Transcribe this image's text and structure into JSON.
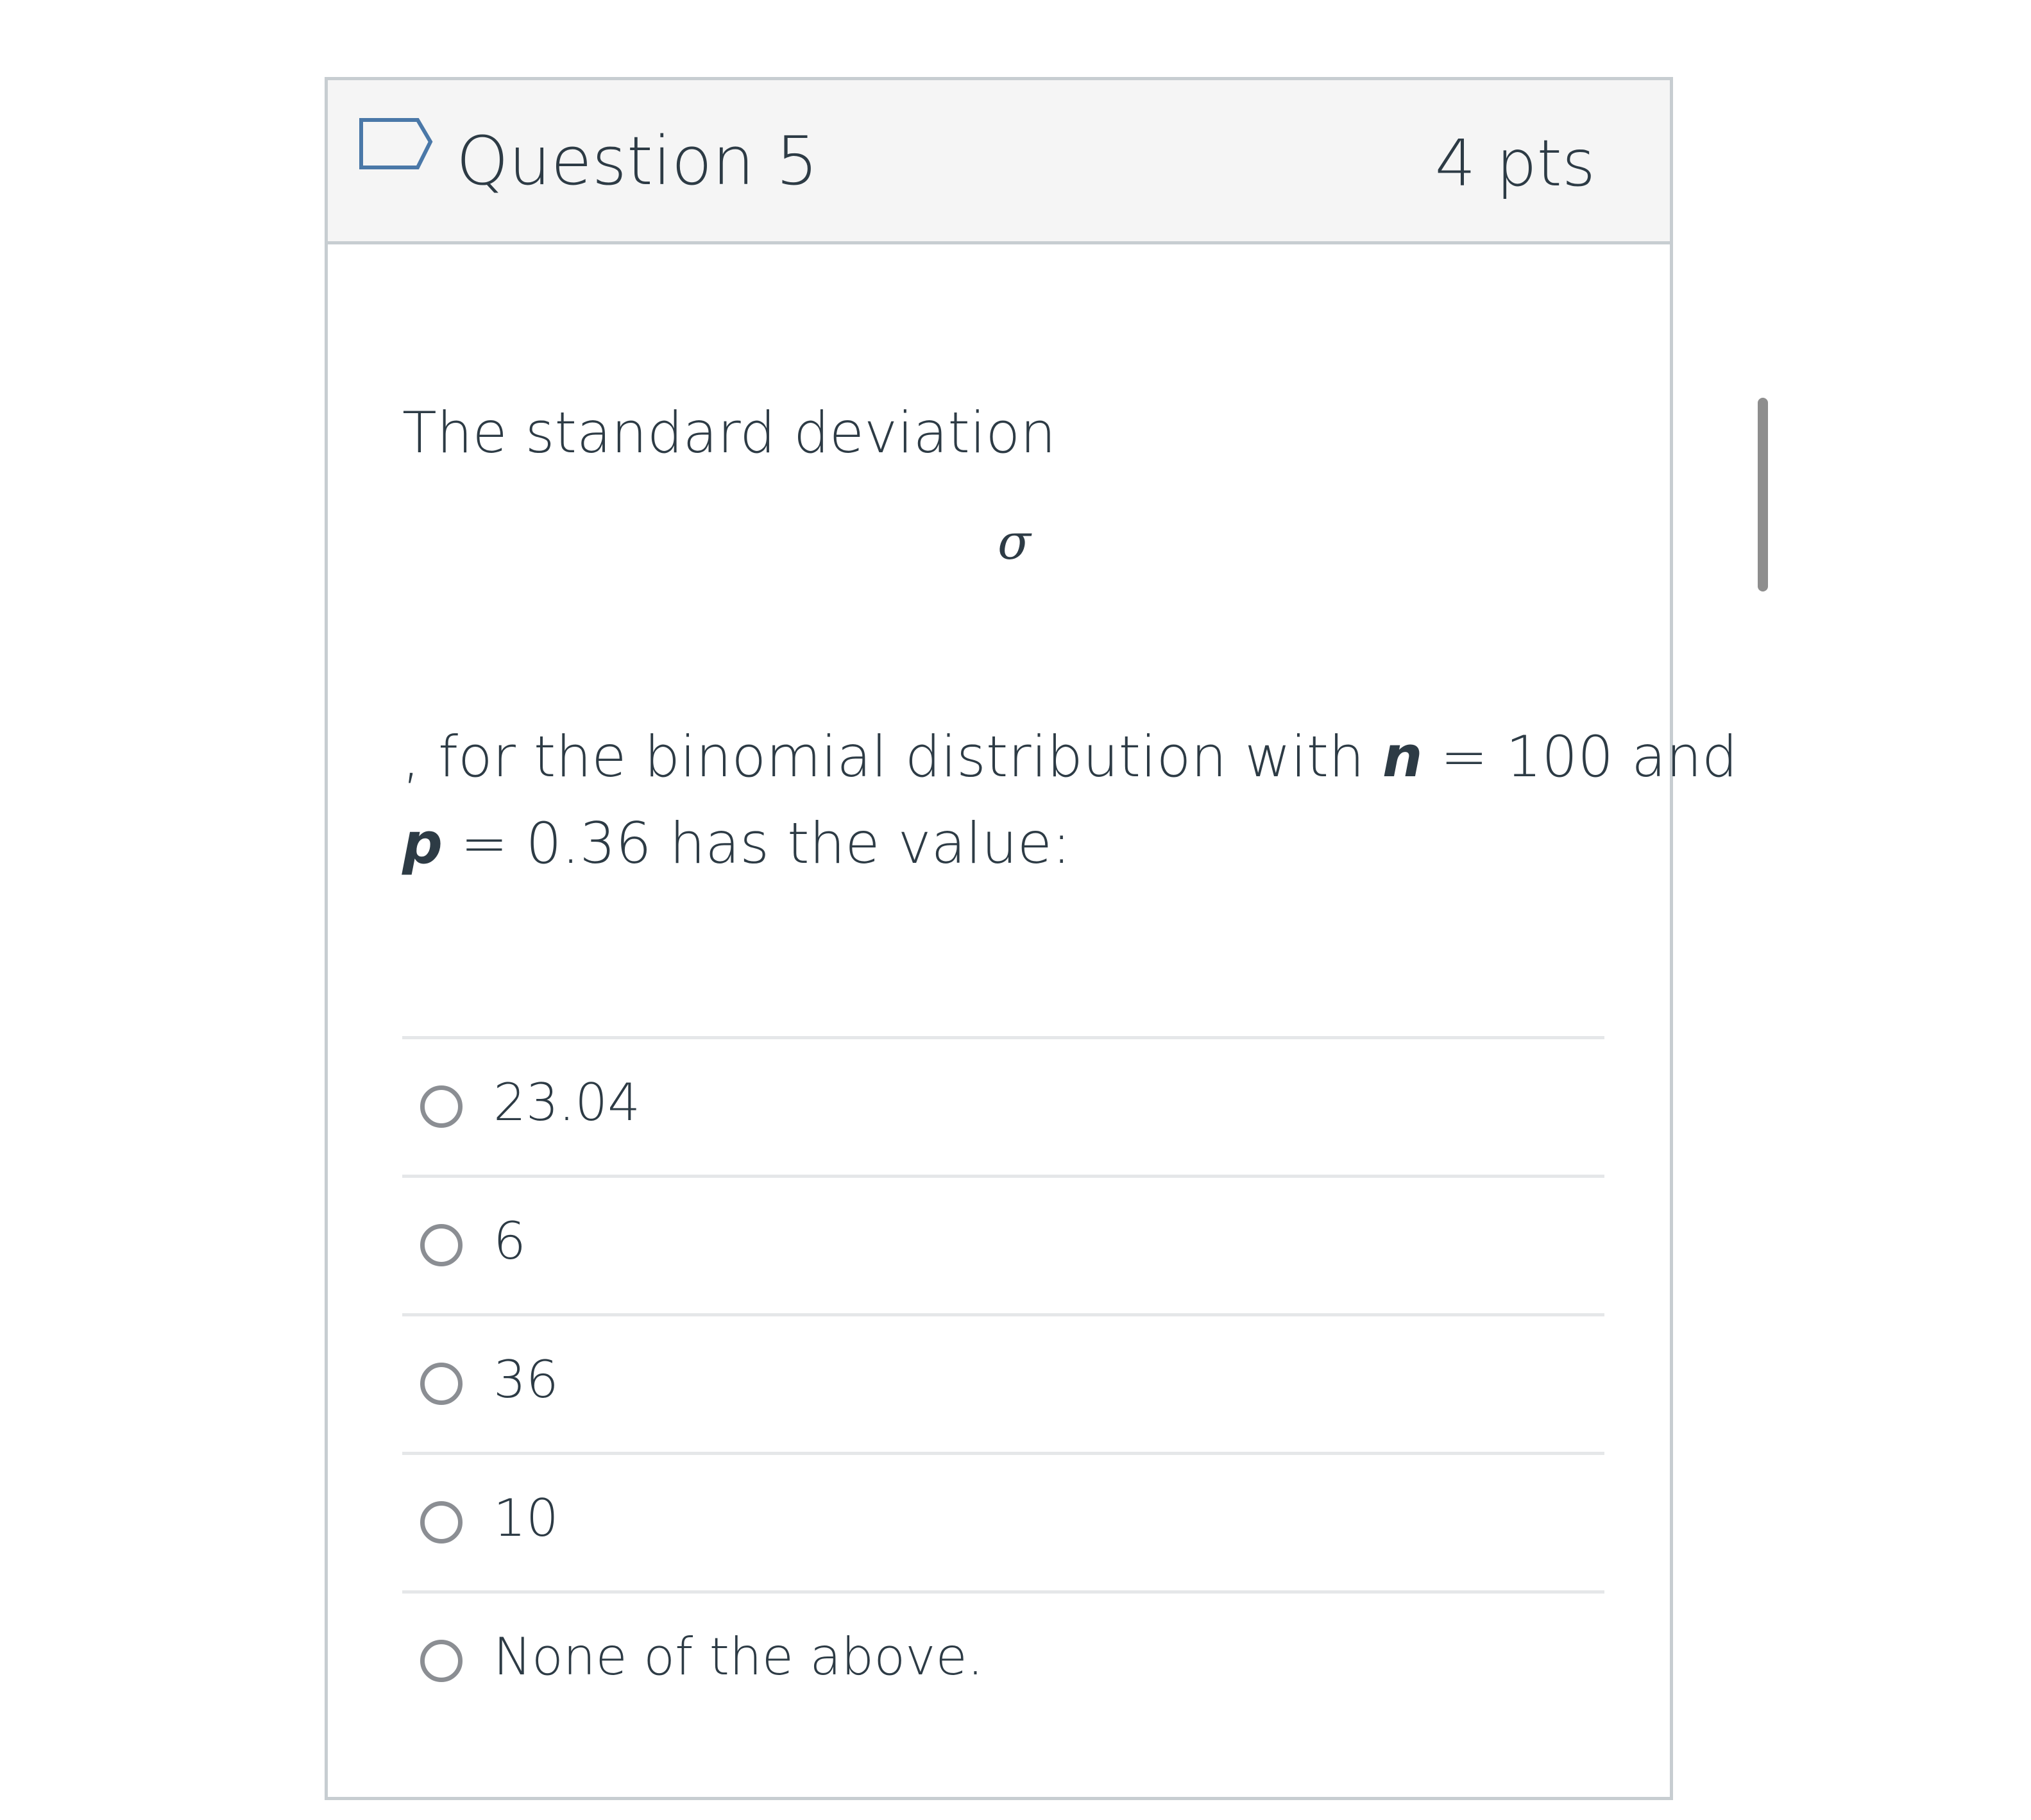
{
  "question": {
    "title": "Question 5",
    "points": "4 pts",
    "flag_icon": "flag-outline-icon"
  },
  "body": {
    "line1": "The standard deviation",
    "symbol": "σ",
    "line2_prefix": ", for the binomial distribution with ",
    "n_var": "n",
    "line2_suffix": " = 100 and",
    "p_var": "p",
    "line3_suffix": " = 0.36 has the value:"
  },
  "answers": [
    {
      "label": "23.04"
    },
    {
      "label": "6"
    },
    {
      "label": "36"
    },
    {
      "label": "10"
    },
    {
      "label": "None of the above."
    }
  ],
  "colors": {
    "header_bg": "#f5f5f5",
    "border": "#c7cdd1",
    "text": "#2d3b45",
    "flag": "#4a78a8",
    "radio": "#8b8e93"
  }
}
